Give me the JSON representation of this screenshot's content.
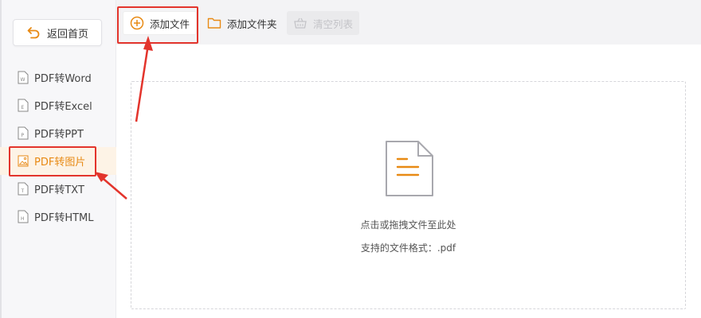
{
  "sidebar": {
    "back_label": "返回首页",
    "items": [
      {
        "label": "PDF转Word",
        "glyph": "W",
        "active": false
      },
      {
        "label": "PDF转Excel",
        "glyph": "E",
        "active": false
      },
      {
        "label": "PDF转PPT",
        "glyph": "P",
        "active": false
      },
      {
        "label": "PDF转图片",
        "glyph": "img",
        "active": true
      },
      {
        "label": "PDF转TXT",
        "glyph": "T",
        "active": false
      },
      {
        "label": "PDF转HTML",
        "glyph": "H",
        "active": false
      }
    ]
  },
  "toolbar": {
    "add_file_label": "添加文件",
    "add_folder_label": "添加文件夹",
    "clear_list_label": "清空列表"
  },
  "drop_zone": {
    "hint": "点击或拖拽文件至此处",
    "formats": "支持的文件格式：.pdf"
  },
  "colors": {
    "accent": "#e88a14",
    "highlight_red": "#e3342c",
    "active_bg": "#fdf3e6"
  },
  "icons": {
    "back": "back-arrow-icon",
    "add": "plus-circle-icon",
    "folder": "folder-icon",
    "clear": "basket-icon",
    "document": "document-icon"
  }
}
